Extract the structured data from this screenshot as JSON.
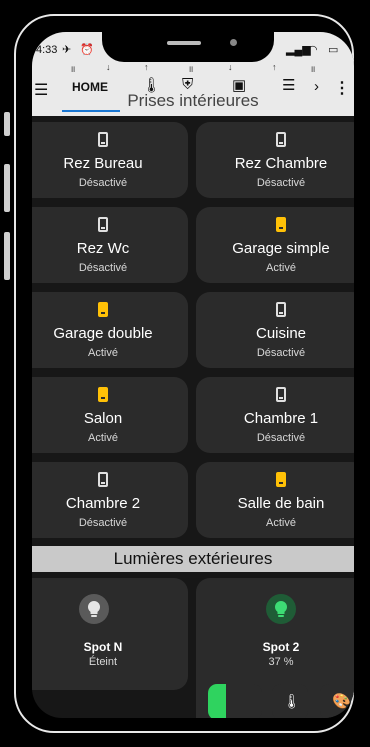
{
  "status": {
    "time": "4:33"
  },
  "tabs": {
    "home_label": "HOME"
  },
  "section_interior": {
    "title": "Prises intérieures"
  },
  "section_exterior": {
    "title": "Lumières extérieures"
  },
  "outlets": [
    {
      "name": "Rez Bureau",
      "state": "Désactivé",
      "on": false
    },
    {
      "name": "Rez Chambre",
      "state": "Désactivé",
      "on": false
    },
    {
      "name": "Rez Wc",
      "state": "Désactivé",
      "on": false
    },
    {
      "name": "Garage simple",
      "state": "Activé",
      "on": true
    },
    {
      "name": "Garage double",
      "state": "Activé",
      "on": true
    },
    {
      "name": "Cuisine",
      "state": "Désactivé",
      "on": false
    },
    {
      "name": "Salon",
      "state": "Activé",
      "on": true
    },
    {
      "name": "Chambre 1",
      "state": "Désactivé",
      "on": false
    },
    {
      "name": "Chambre 2",
      "state": "Désactivé",
      "on": false
    },
    {
      "name": "Salle de bain",
      "state": "Activé",
      "on": true
    }
  ],
  "lights": [
    {
      "name": "Spot N",
      "state": "Éteint",
      "color": "#5a5a5a",
      "icon_color": "#e6e6e6"
    },
    {
      "name": "Spot 2",
      "state": "37 %",
      "color": "#1f5c36",
      "icon_color": "#3ddc74"
    }
  ],
  "colors": {
    "accent": "#ffc107",
    "light_on": "#2fd35f"
  }
}
